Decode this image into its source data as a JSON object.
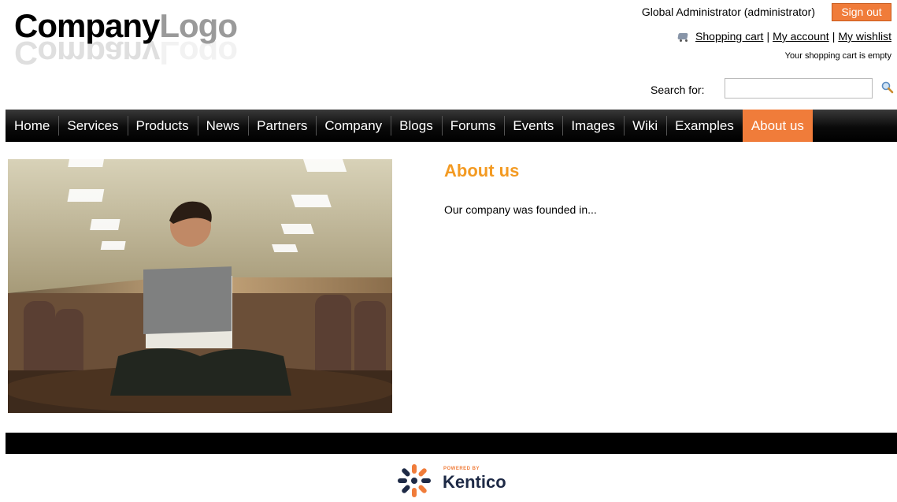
{
  "logo": {
    "company": "Company",
    "logo": "Logo"
  },
  "header": {
    "user": "Global Administrator (administrator)",
    "sign_out": "Sign out",
    "shopping_cart": "Shopping cart",
    "sep1": "|",
    "my_account": "My account",
    "sep2": "|",
    "my_wishlist": "My wishlist",
    "cart_status": "Your shopping cart is empty",
    "search_label": "Search for:",
    "search_value": ""
  },
  "nav": {
    "items": [
      "Home",
      "Services",
      "Products",
      "News",
      "Partners",
      "Company",
      "Blogs",
      "Forums",
      "Events",
      "Images",
      "Wiki",
      "Examples",
      "About us"
    ],
    "active": "About us"
  },
  "content": {
    "title": "About us",
    "text": "Our company was founded in..."
  },
  "footer": {
    "powered": "POWERED BY",
    "brand": "Kentico"
  },
  "colors": {
    "accent": "#f07c3a",
    "title": "#f39a22",
    "nav": "#000000"
  }
}
